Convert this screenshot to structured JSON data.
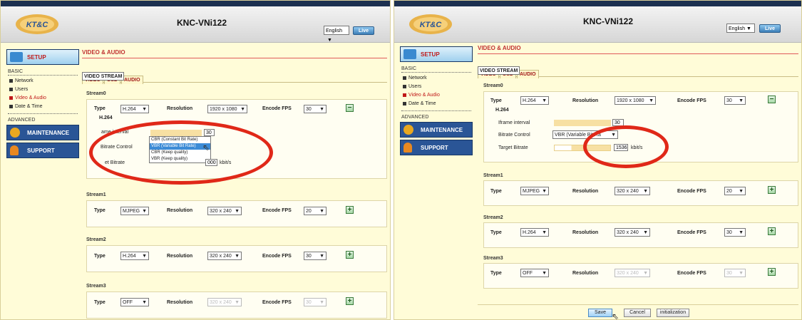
{
  "header": {
    "model": "KNC-VNi122",
    "language": "English",
    "live_label": "Live",
    "logo_text": "KT&C"
  },
  "nav": {
    "setup": "SETUP",
    "maintenance": "MAINTENANCE",
    "support": "SUPPORT",
    "basic": "BASIC",
    "advanced": "ADVANCED",
    "items": [
      "Network",
      "Users",
      "Video & Audio",
      "Date & Time"
    ],
    "active_item": "Video & Audio"
  },
  "page": {
    "title": "VIDEO & AUDIO",
    "tabs": [
      "VIDEO STREAM",
      "VIDEO",
      "OSD",
      "AUDIO"
    ],
    "selected_tab": "VIDEO STREAM"
  },
  "labels": {
    "type": "Type",
    "resolution": "Resolution",
    "encode_fps": "Encode FPS",
    "h264": "H.264",
    "iframe": "Iframe interval",
    "bitrate_control": "Bitrate Control",
    "target_bitrate": "Target Bitrate",
    "kbits": "kbit/s"
  },
  "streams": [
    {
      "name": "Stream0",
      "type": "H.264",
      "resolution": "1920 x 1080",
      "fps": "30",
      "expanded": true
    },
    {
      "name": "Stream1",
      "type": "MJPEG",
      "resolution": "320 x 240",
      "fps": "20",
      "expanded": false
    },
    {
      "name": "Stream2",
      "type": "H.264",
      "resolution": "320 x 240",
      "fps": "30",
      "expanded": false
    },
    {
      "name": "Stream3",
      "type": "OFF",
      "resolution": "320 x 240",
      "fps": "30",
      "expanded": false,
      "disabled": true
    }
  ],
  "left_panel": {
    "iframe_value": "30",
    "bitrate_options": [
      "CBR (Constant Bit Rate)",
      "VBR (Variable Bit Rate)",
      "CBR (Keep quality)",
      "VBR (Keep quality)"
    ],
    "highlighted_option": "VBR (Variable Bit Rate)",
    "target_value": "000",
    "iframe_label_visible": "ame interval",
    "target_label_visible": "et Bitrate"
  },
  "right_panel": {
    "iframe_value": "30",
    "bitrate_control_value": "VBR (Variable Bit Ra",
    "target_value": "1536",
    "save": "Save",
    "cancel": "Cancel",
    "initialization": "initialization"
  }
}
